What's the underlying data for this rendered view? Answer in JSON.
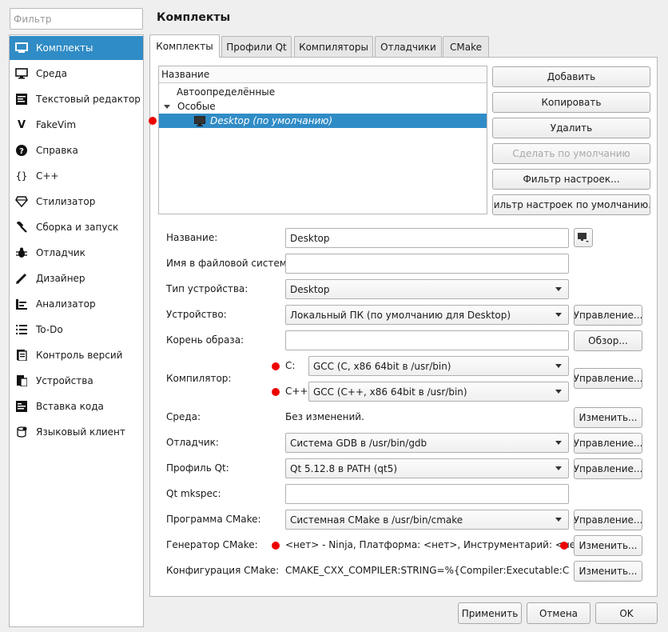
{
  "filter": {
    "placeholder": "Фильтр"
  },
  "sidebar": {
    "items": [
      {
        "label": "Комплекты",
        "icon": "kits-icon"
      },
      {
        "label": "Среда",
        "icon": "monitor-icon"
      },
      {
        "label": "Текстовый редактор",
        "icon": "text-editor-icon"
      },
      {
        "label": "FakeVim",
        "icon": "fakevim-icon"
      },
      {
        "label": "Справка",
        "icon": "help-icon"
      },
      {
        "label": "C++",
        "icon": "braces-icon"
      },
      {
        "label": "Стилизатор",
        "icon": "diamond-icon"
      },
      {
        "label": "Сборка и запуск",
        "icon": "hammer-icon"
      },
      {
        "label": "Отладчик",
        "icon": "bug-icon"
      },
      {
        "label": "Дизайнер",
        "icon": "pencil-icon"
      },
      {
        "label": "Анализатор",
        "icon": "analyzer-icon"
      },
      {
        "label": "To-Do",
        "icon": "todo-list-icon"
      },
      {
        "label": "Контроль версий",
        "icon": "version-control-icon"
      },
      {
        "label": "Устройства",
        "icon": "devices-icon"
      },
      {
        "label": "Вставка кода",
        "icon": "snippet-icon"
      },
      {
        "label": "Языковый клиент",
        "icon": "language-client-icon"
      }
    ]
  },
  "page_title": "Комплекты",
  "tabs": [
    "Комплекты",
    "Профили Qt",
    "Компиляторы",
    "Отладчики",
    "CMake"
  ],
  "tree": {
    "header": "Название",
    "auto": "Автоопределённые",
    "manual": "Особые",
    "selected": "Desktop (по умолчанию)"
  },
  "side_buttons": {
    "add": "Добавить",
    "copy": "Копировать",
    "remove": "Удалить",
    "make_default": "Сделать по умолчанию",
    "settings_filter": "Фильтр настроек...",
    "default_settings_filter": "Фильтр настроек по умолчанию..."
  },
  "form": {
    "name_label": "Название:",
    "name_value": "Desktop",
    "fs_name_label": "Имя в файловой системе:",
    "fs_name_value": "",
    "device_type_label": "Тип устройства:",
    "device_type_value": "Desktop",
    "device_label": "Устройство:",
    "device_value": "Локальный ПК (по умолчанию для Desktop)",
    "sysroot_label": "Корень образа:",
    "sysroot_value": "",
    "compiler_label": "Компилятор:",
    "compiler_c_label": "C:",
    "compiler_c_value": "GCC (C, x86 64bit в /usr/bin)",
    "compiler_cxx_label": "C++:",
    "compiler_cxx_value": "GCC (C++, x86 64bit в /usr/bin)",
    "env_label": "Среда:",
    "env_value": "Без изменений.",
    "debugger_label": "Отладчик:",
    "debugger_value": "Система GDB в /usr/bin/gdb",
    "qt_label": "Профиль Qt:",
    "qt_value": "Qt 5.12.8 в PATH (qt5)",
    "mkspec_label": "Qt mkspec:",
    "mkspec_value": "",
    "cmake_label": "Программа CMake:",
    "cmake_value": "Системная CMake в /usr/bin/cmake",
    "generator_label": "Генератор CMake:",
    "generator_value": "<нет> - Ninja, Платформа: <нет>, Инструментарий: <нет>",
    "cmake_config_label": "Конфигурация CMake:",
    "cmake_config_value": "CMAKE_CXX_COMPILER:STRING=%{Compiler:Executable:Cxx}..."
  },
  "buttons": {
    "manage": "Управление...",
    "browse": "Обзор...",
    "change": "Изменить..."
  },
  "dialog": {
    "apply": "Применить",
    "cancel": "Отмена",
    "ok": "OK"
  },
  "colors": {
    "accent": "#308cc6",
    "marker": "#e00000"
  }
}
